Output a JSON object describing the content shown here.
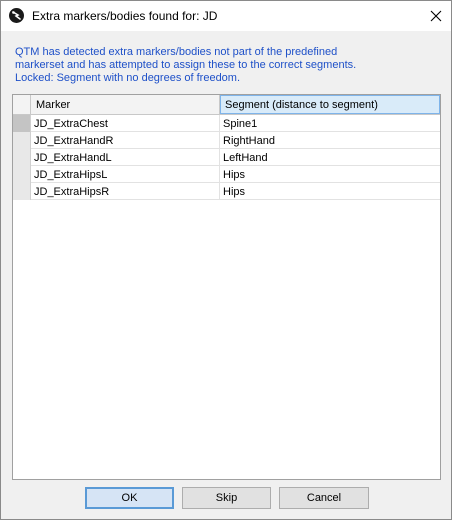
{
  "window": {
    "title": "Extra markers/bodies found for: JD",
    "app_icon": "qtm-logo-icon",
    "close_icon": "close-icon"
  },
  "info": {
    "line1": "QTM has detected extra markers/bodies not part of the predefined",
    "line2": "markerset and has attempted to assign these to the correct segments.",
    "line3": "Locked: Segment with no degrees of freedom."
  },
  "table": {
    "columns": [
      "Marker",
      "Segment (distance to segment)"
    ],
    "rows": [
      {
        "marker": "JD_ExtraChest",
        "segment": "Spine1"
      },
      {
        "marker": "JD_ExtraHandR",
        "segment": "RightHand"
      },
      {
        "marker": "JD_ExtraHandL",
        "segment": "LeftHand"
      },
      {
        "marker": "JD_ExtraHipsL",
        "segment": "Hips"
      },
      {
        "marker": "JD_ExtraHipsR",
        "segment": "Hips"
      }
    ]
  },
  "buttons": {
    "ok": "OK",
    "skip": "Skip",
    "cancel": "Cancel"
  },
  "colors": {
    "info_text": "#1e50c8",
    "default_button_border": "#5a9ad6",
    "selected_header": "#d9ebf9"
  }
}
